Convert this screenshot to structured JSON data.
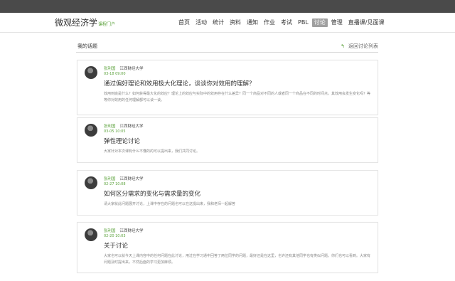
{
  "brand": {
    "title": "微观经济学",
    "subtitle": "课程门户"
  },
  "nav": {
    "items": [
      {
        "label": "首页"
      },
      {
        "label": "活动"
      },
      {
        "label": "统计"
      },
      {
        "label": "资料"
      },
      {
        "label": "通知"
      },
      {
        "label": "作业"
      },
      {
        "label": "考试"
      },
      {
        "label": "PBL"
      },
      {
        "label": "讨论",
        "active": true
      },
      {
        "label": "管理"
      },
      {
        "label": "直播课/见面课"
      }
    ]
  },
  "section": {
    "title": "我的话题",
    "back_label": "返回讨论列表"
  },
  "posts": [
    {
      "author": "张利国",
      "school": "江西财经大学",
      "date": "03-18 09:00",
      "title": "通过偏好理论和效用极大化理论，谈谈你对效用的理解？",
      "desc": "效用到底是什么？如何获得最大化的效应？理论上的效应与实际中的效用存在什么差异？同一个商品对不同的人或者同一个商品在不同的时间点，其效用会发生变化吗？等等你对效用的任何理解都可以谈一谈。"
    },
    {
      "author": "张利国",
      "school": "江西财经大学",
      "date": "03-05 10:05",
      "title": "弹性理论讨论",
      "desc": "大家针对本次课有什么不懂的的可以提出来，我们共同讨论。"
    },
    {
      "author": "张利国",
      "school": "江西财经大学",
      "date": "02-27 10:08",
      "title": "如何区分需求的变化与需求量的变化",
      "desc": "请大家就此问题展开讨论，上课中存在的问题也可以在这提出来，我和老师一起解答"
    },
    {
      "author": "张利国",
      "school": "江西财经大学",
      "date": "02-20 10:03",
      "title": "关于讨论",
      "desc": "大家也可以就今天上课内容中的任何问题在此讨论，用过在学习通中回答了两位同学的问题，最好还是在这里，也许还有其他同学也有类似问题，你们也可以看到。大家有问题及时提出来，不然后面的学习更加麻烦。"
    }
  ],
  "colors": {
    "accent": "#5aa13a",
    "topbar": "#4a4a4a",
    "nav_active": "#a0a0a0"
  }
}
